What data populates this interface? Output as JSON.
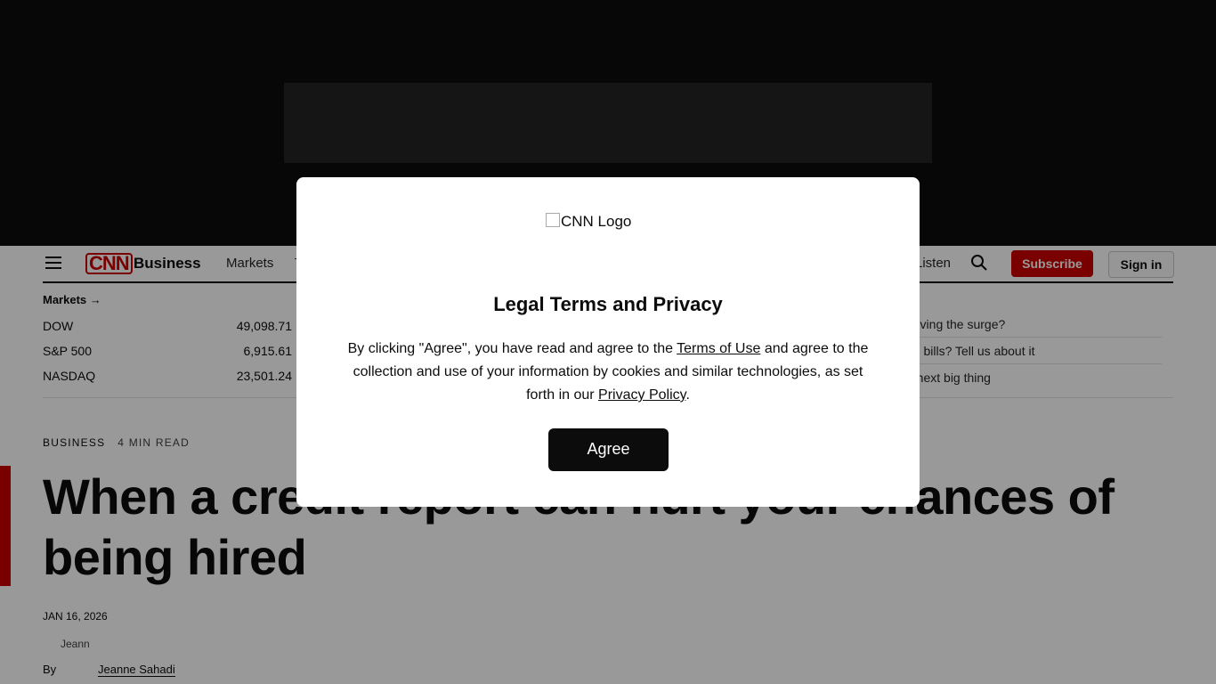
{
  "nav": {
    "section": "Business",
    "links": [
      "Markets",
      "T"
    ],
    "listen": "Listen",
    "subscribe": "Subscribe",
    "sign_in": "Sign in"
  },
  "markets": {
    "title": "Markets →",
    "rows": [
      {
        "name": "DOW",
        "value": "49,098.71"
      },
      {
        "name": "S&P 500",
        "value": "6,915.61"
      },
      {
        "name": "NASDAQ",
        "value": "23,501.24"
      }
    ]
  },
  "headlines": [
    "driving the surge?",
    "ng bills? Tell us about it",
    "e next big thing"
  ],
  "article": {
    "section": "BUSINESS",
    "read_time": "4 MIN READ",
    "headline": "When a credit report can hurt your chances of being hired",
    "date": "JAN 16, 2026",
    "by": "By",
    "author": "Jeanne Sahadi",
    "avatar_alt": "Jeann"
  },
  "modal": {
    "logo_alt": "CNN Logo",
    "title": "Legal Terms and Privacy",
    "text_1": "By clicking \"Agree\", you have read and agree to the ",
    "terms_link": "Terms of Use",
    "text_2": " and agree to the collection and use of your information by cookies and similar technologies, as set forth in our ",
    "privacy_link": "Privacy Policy",
    "text_3": ".",
    "agree": "Agree"
  },
  "colors": {
    "brand_red": "#cc0000",
    "dark": "#0c0c0c"
  }
}
